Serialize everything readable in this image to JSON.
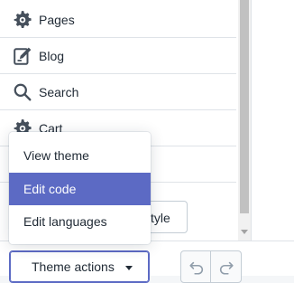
{
  "nav": {
    "items": [
      {
        "label": "Pages",
        "icon": "gear-icon"
      },
      {
        "label": "Blog",
        "icon": "edit-icon"
      },
      {
        "label": "Search",
        "icon": "search-icon"
      },
      {
        "label": "Cart",
        "icon": "gear-icon"
      }
    ]
  },
  "toolbar": {
    "theme_actions_label": "Theme actions",
    "style_label": "style",
    "undo_icon": "undo-icon",
    "redo_icon": "redo-icon"
  },
  "menu": {
    "items": [
      {
        "label": "View theme",
        "active": false
      },
      {
        "label": "Edit code",
        "active": true
      },
      {
        "label": "Edit languages",
        "active": false
      }
    ],
    "active_color": "#5c6ac4"
  }
}
